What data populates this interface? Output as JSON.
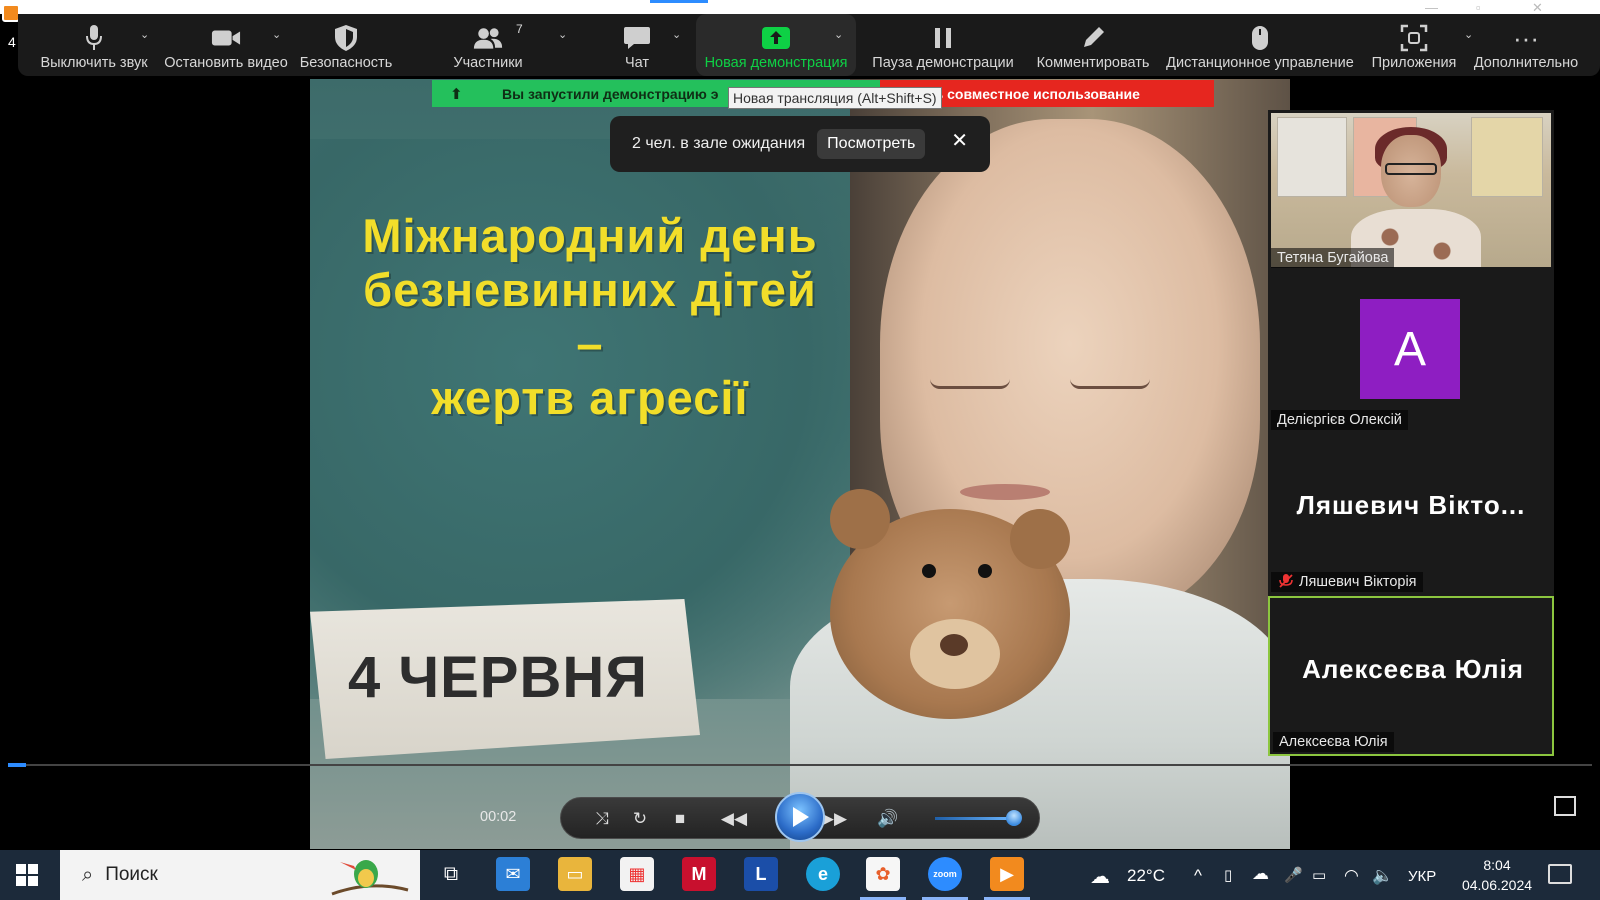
{
  "window": {
    "left_number": "4"
  },
  "toolbar": {
    "mute": "Выключить звук",
    "stop_video": "Остановить видео",
    "security": "Безопасность",
    "participants": "Участники",
    "participants_count": "7",
    "chat": "Чат",
    "new_share": "Новая демонстрация",
    "pause_share": "Пауза демонстрации",
    "annotate": "Комментировать",
    "remote_control": "Дистанционное управление",
    "apps": "Приложения",
    "more": "Дополнительно",
    "accent_color": "#0ed145"
  },
  "share_banner": {
    "green_text": "Вы запустили демонстрацию э",
    "red_text": "овить совместное использование"
  },
  "tooltip": {
    "text": "Новая трансляция (Alt+Shift+S)"
  },
  "waiting_room": {
    "text": "2 чел. в зале ожидания",
    "view_button": "Посмотреть",
    "close_icon": "close-icon"
  },
  "slide": {
    "title_line1": "Міжнародний день",
    "title_line2": "безневинних дітей",
    "title_line3": "–",
    "title_line4": "жертв агресії",
    "date": "4 ЧЕРВНЯ"
  },
  "participants": [
    {
      "name": "Тетяна Бугайова",
      "type": "video"
    },
    {
      "name": "Делієргієв Олексій",
      "type": "avatar",
      "avatar_letter": "A",
      "avatar_color": "#8e1ec2"
    },
    {
      "name": "Ляшевич Вікторія",
      "display_name": "Ляшевич Вікто...",
      "type": "name",
      "muted": true
    },
    {
      "name": "Алексеєва Юлія",
      "display_name": "Алексеєва Юлія",
      "type": "name",
      "active_speaker": true
    }
  ],
  "player": {
    "time": "00:02"
  },
  "taskbar": {
    "search_placeholder": "Поиск",
    "temperature": "22°C",
    "language": "УКР",
    "time": "8:04",
    "date": "04.06.2024",
    "apps": [
      "task-view-icon",
      "mail-icon",
      "file-explorer-icon",
      "store-icon",
      "mcafee-icon",
      "l-app-icon",
      "edge-icon",
      "photo-app-icon",
      "zoom-icon",
      "media-player-icon"
    ]
  }
}
